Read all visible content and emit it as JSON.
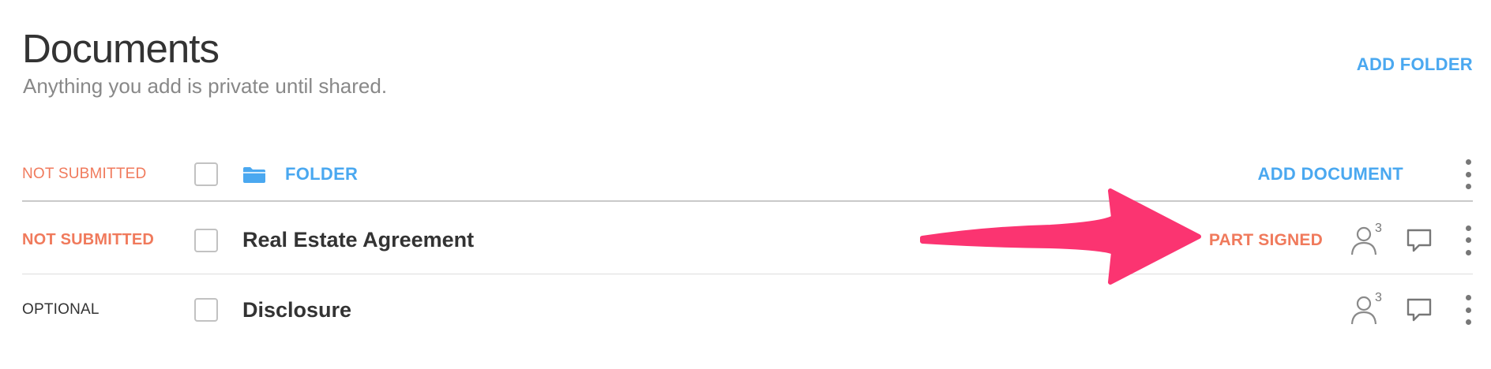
{
  "header": {
    "title": "Documents",
    "subtitle": "Anything you add is private until shared.",
    "add_folder_label": "ADD FOLDER"
  },
  "folder_row": {
    "status": "NOT SUBMITTED",
    "icon": "folder-icon",
    "label": "FOLDER",
    "add_document_label": "ADD DOCUMENT"
  },
  "documents": [
    {
      "status": "NOT SUBMITTED",
      "name": "Real Estate Agreement",
      "signing_status": "PART SIGNED",
      "share_count": "3"
    },
    {
      "status": "OPTIONAL",
      "name": "Disclosure",
      "share_count": "3"
    }
  ],
  "colors": {
    "accent_blue": "#4aa8f0",
    "status_red": "#f07a5c",
    "annotation_pink": "#fb3471"
  }
}
